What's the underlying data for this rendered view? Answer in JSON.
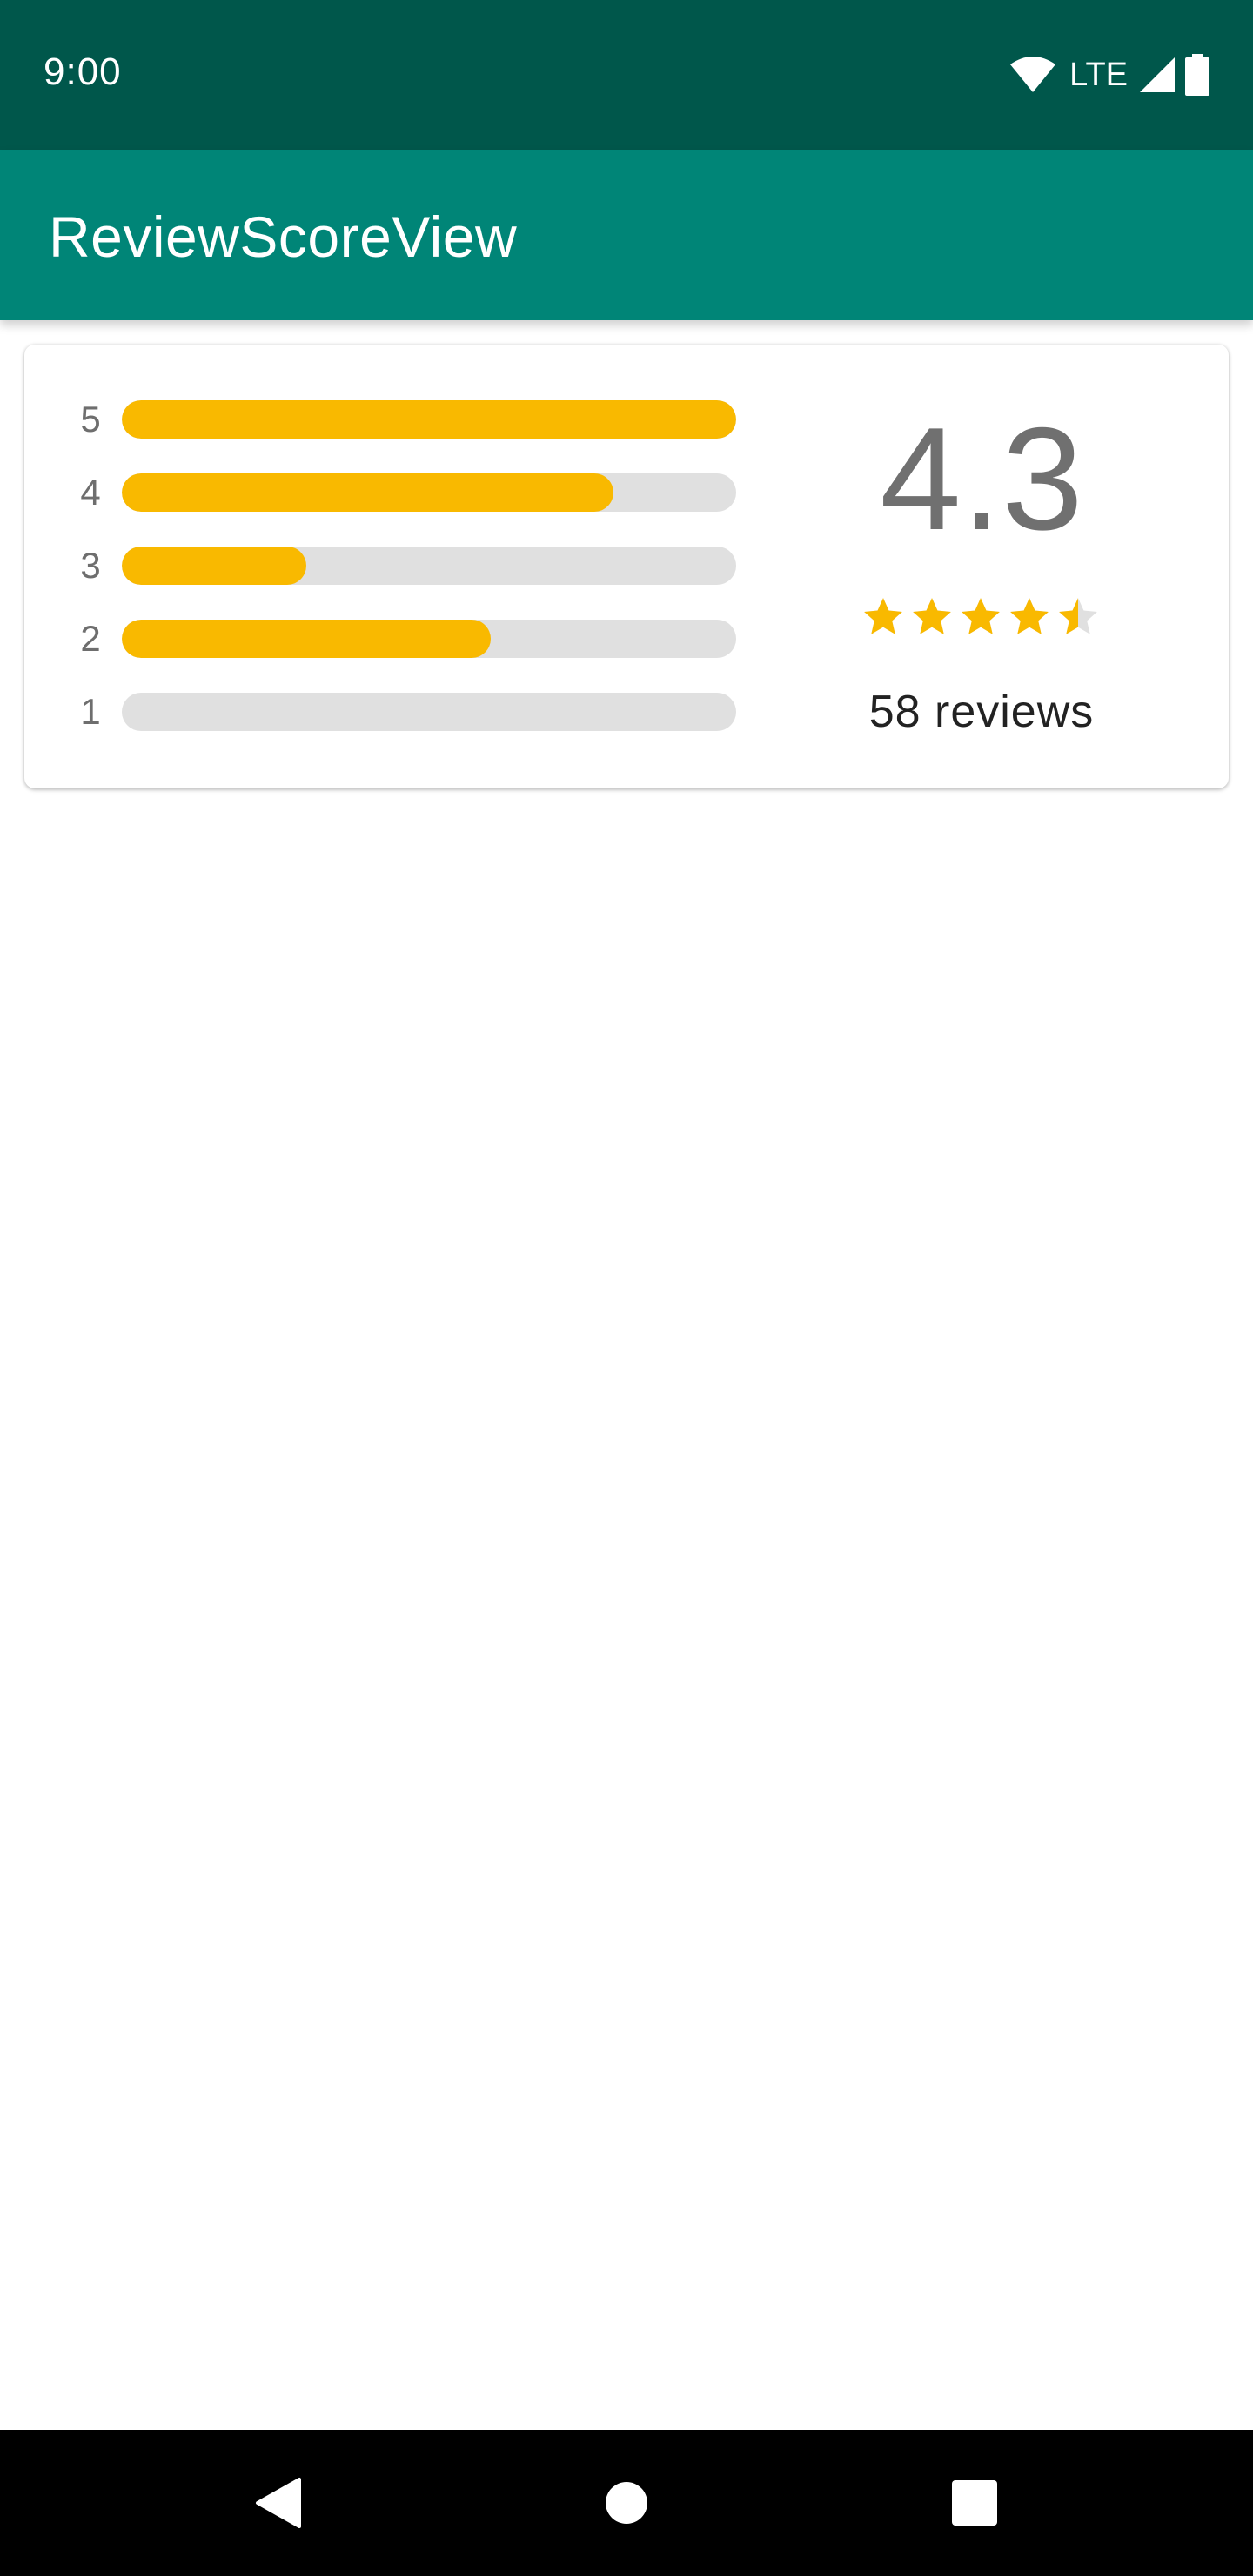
{
  "status_bar": {
    "time": "9:00",
    "network": "LTE",
    "icons": [
      "wifi-icon",
      "cellular-signal-icon",
      "battery-icon"
    ]
  },
  "app_bar": {
    "title": "ReviewScoreView"
  },
  "review_card": {
    "distribution": [
      {
        "label": "5",
        "fraction": 1.0
      },
      {
        "label": "4",
        "fraction": 0.8
      },
      {
        "label": "3",
        "fraction": 0.3
      },
      {
        "label": "2",
        "fraction": 0.6
      },
      {
        "label": "1",
        "fraction": 0.0
      }
    ],
    "score": "4.3",
    "star_rating": 4.3,
    "max_stars": 5,
    "review_count_text": "58 reviews"
  },
  "colors": {
    "status_bar": "#00574b",
    "app_bar": "#008577",
    "bar_fill": "#f9b900",
    "bar_track": "#e0e0e0",
    "star_filled": "#f9b900",
    "star_empty": "#e0e0e0"
  },
  "nav_bar": {
    "buttons": [
      "back-icon",
      "home-icon",
      "recents-icon"
    ]
  }
}
